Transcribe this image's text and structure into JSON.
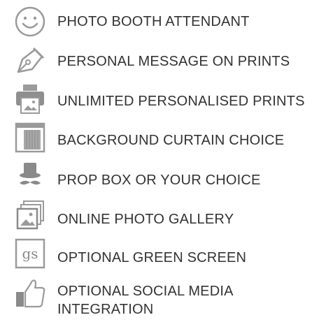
{
  "features": [
    {
      "icon": "smiley-face-icon",
      "label": "PHOTO BOOTH ATTENDANT"
    },
    {
      "icon": "pen-nib-icon",
      "label": "PERSONAL MESSAGE ON PRINTS"
    },
    {
      "icon": "printer-icon",
      "label": "UNLIMITED PERSONALISED PRINTS"
    },
    {
      "icon": "curtain-icon",
      "label": "BACKGROUND CURTAIN CHOICE"
    },
    {
      "icon": "top-hat-mustache-icon",
      "label": "PROP BOX OR YOUR CHOICE"
    },
    {
      "icon": "photo-stack-icon",
      "label": "ONLINE PHOTO GALLERY"
    },
    {
      "icon": "green-screen-icon",
      "label": "OPTIONAL GREEN SCREEN",
      "icon_text": "gs"
    },
    {
      "icon": "thumbs-up-icon",
      "label_line1": "OPTIONAL SOCIAL MEDIA",
      "label_line2": "INTEGRATION"
    }
  ],
  "colors": {
    "icon": "#9a9a9a",
    "icon_dark": "#7a7a7a",
    "text": "#333333",
    "background": "#ffffff"
  }
}
